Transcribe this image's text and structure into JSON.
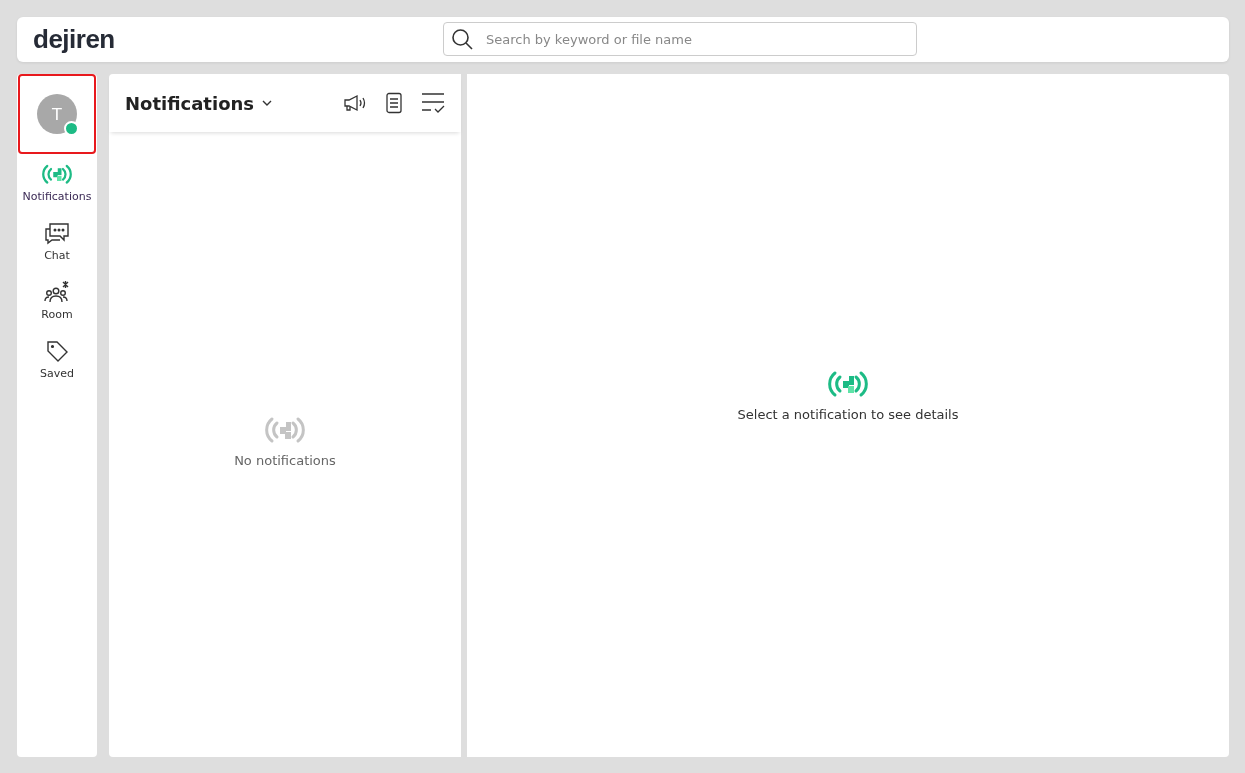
{
  "header": {
    "logo": "dejiren",
    "search": {
      "placeholder": "Search by keyword or file name"
    }
  },
  "sidebar": {
    "avatar": {
      "initial": "T",
      "online": true,
      "highlighted": true
    },
    "items": [
      {
        "kind": "notifications",
        "label": "Notifications",
        "selected": true
      },
      {
        "kind": "chat",
        "label": "Chat",
        "selected": false
      },
      {
        "kind": "room",
        "label": "Room",
        "selected": false
      },
      {
        "kind": "saved",
        "label": "Saved",
        "selected": false
      }
    ]
  },
  "list_panel": {
    "title": "Notifications",
    "empty_text": "No notifications"
  },
  "detail_panel": {
    "empty_text": "Select a notification to see details"
  }
}
